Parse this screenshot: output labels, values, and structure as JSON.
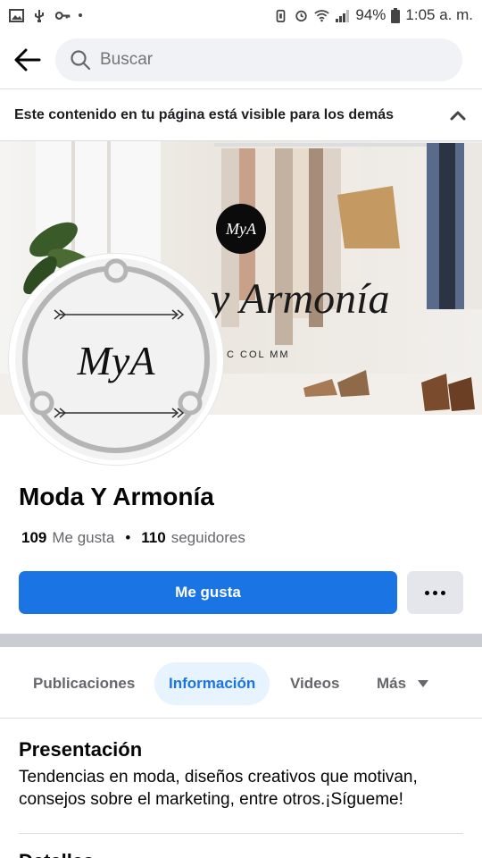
{
  "status_bar": {
    "battery": "94%",
    "time": "1:05 a. m."
  },
  "search": {
    "placeholder": "Buscar"
  },
  "visibility_banner": {
    "text": "Este contenido en tu página está visible para los demás"
  },
  "cover": {
    "logo_text": "MyA",
    "brand_text": "y Armonía",
    "tagline": "C COL MM"
  },
  "profile": {
    "avatar_text": "MyA",
    "name": "Moda Y Armonía",
    "likes_count": "109",
    "likes_label": "Me gusta",
    "separator": "•",
    "followers_count": "110",
    "followers_label": "seguidores"
  },
  "actions": {
    "like_label": "Me gusta"
  },
  "tabs": [
    {
      "label": "Publicaciones",
      "active": false
    },
    {
      "label": "Información",
      "active": true
    },
    {
      "label": "Videos",
      "active": false
    },
    {
      "label": "Más",
      "active": false
    }
  ],
  "about": {
    "title": "Presentación",
    "description": "Tendencias en moda, diseños creativos que motivan, consejos sobre el marketing, entre otros.¡Sígueme!",
    "next_title": "Detalles"
  },
  "colors": {
    "accent": "#1b74e4",
    "tab_active_bg": "#e7f3ff",
    "divider": "#c9ccd1"
  }
}
